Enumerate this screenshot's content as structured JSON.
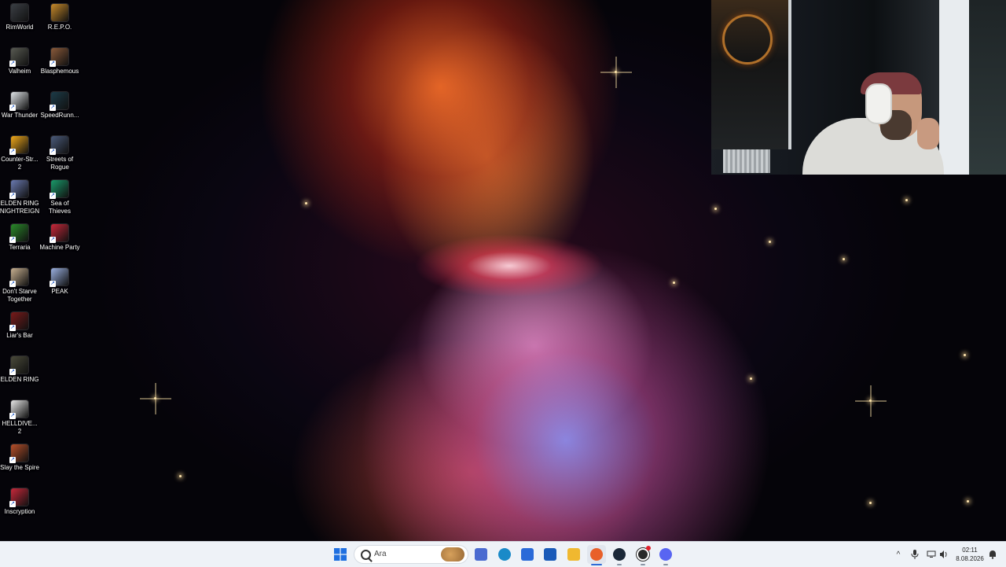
{
  "desktop": {
    "icons": [
      {
        "label": "RimWorld",
        "icon": "rimworld-icon",
        "color": "#3b3f45"
      },
      {
        "label": "R.E.P.O.",
        "icon": "repo-icon",
        "color": "#c88a2a"
      },
      {
        "label": "Valheim",
        "icon": "valheim-icon",
        "color": "#585a52"
      },
      {
        "label": "Blasphemous",
        "icon": "blasphemous-icon",
        "color": "#8a5a3a"
      },
      {
        "label": "War Thunder",
        "icon": "war-thunder-icon",
        "color": "#e0e4e8"
      },
      {
        "label": "SpeedRunn...",
        "icon": "speedrunners-icon",
        "color": "#1c3b48"
      },
      {
        "label": "Counter-Str... 2",
        "icon": "counter-strike-icon",
        "color": "#f0a81a"
      },
      {
        "label": "Streets of Rogue",
        "icon": "streets-of-rogue-icon",
        "color": "#4a5a7a"
      },
      {
        "label": "ELDEN RING NIGHTREIGN",
        "icon": "elden-ring-nightreign-icon",
        "color": "#6a7ab0"
      },
      {
        "label": "Sea of Thieves",
        "icon": "sea-of-thieves-icon",
        "color": "#1a9a6a"
      },
      {
        "label": "Terraria",
        "icon": "terraria-icon",
        "color": "#2a8a2a"
      },
      {
        "label": "Machine Party",
        "icon": "machine-party-icon",
        "color": "#c8283a"
      },
      {
        "label": "Don't Starve Together",
        "icon": "dont-starve-together-icon",
        "color": "#c8b090"
      },
      {
        "label": "PEAK",
        "icon": "peak-icon",
        "color": "#9ab0e0"
      },
      {
        "label": "Liar's Bar",
        "icon": "liars-bar-icon",
        "color": "#7a1a1a"
      },
      {
        "label": "ELDEN RING",
        "icon": "elden-ring-icon",
        "color": "#4a4a3a"
      },
      {
        "label": "HELLDIVE... 2",
        "icon": "helldivers-icon",
        "color": "#e8e8e8"
      },
      {
        "label": "Slay the Spire",
        "icon": "slay-the-spire-icon",
        "color": "#b8502a"
      },
      {
        "label": "Inscryption",
        "icon": "inscryption-icon",
        "color": "#c8283a"
      }
    ]
  },
  "taskbar": {
    "search_placeholder": "Ara",
    "apps": [
      {
        "name": "start-button",
        "icon": "windows-logo-icon",
        "color": "#1f6fe0"
      },
      {
        "name": "widgets-button",
        "icon": "widgets-icon",
        "color": "#4a6ad0"
      },
      {
        "name": "edge-button",
        "icon": "edge-icon",
        "color": "#1a8ac8"
      },
      {
        "name": "store-button",
        "icon": "microsoft-store-icon",
        "color": "#2a6ad8"
      },
      {
        "name": "outlook-button",
        "icon": "outlook-icon",
        "color": "#1a5ab8"
      },
      {
        "name": "file-explorer-button",
        "icon": "folder-icon",
        "color": "#f0b830"
      },
      {
        "name": "firefox-button",
        "icon": "firefox-icon",
        "color": "#e8602a"
      },
      {
        "name": "steam-button",
        "icon": "steam-icon",
        "color": "#1b2838"
      },
      {
        "name": "obs-button",
        "icon": "obs-icon",
        "color": "#2a2a2a"
      },
      {
        "name": "discord-button",
        "icon": "discord-icon",
        "color": "#5865f2"
      }
    ],
    "clock_time": "02:11",
    "clock_date": "8.08.2026"
  }
}
